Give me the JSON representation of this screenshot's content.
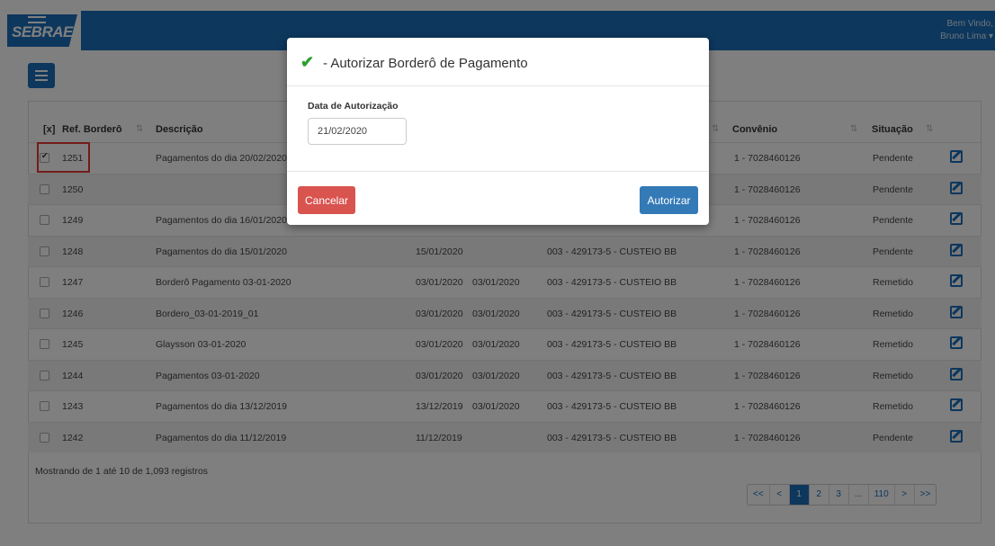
{
  "header": {
    "logo_text": "SEBRAE",
    "welcome": "Bem Vindo,",
    "user_name": "Bruno Lima ▾"
  },
  "table": {
    "columns": [
      "[x]",
      "Ref. Borderô",
      "Descrição",
      "Convênio",
      "Situação"
    ],
    "rows": [
      {
        "ref": "1251",
        "desc": "Pagamentos do dia 20/02/2020",
        "date1": "",
        "date2": "",
        "conta": "",
        "convenio": "1 - 7028460126",
        "situacao": "Pendente",
        "checked": true
      },
      {
        "ref": "1250",
        "desc": "",
        "date1": "",
        "date2": "",
        "conta": "",
        "convenio": "1 - 7028460126",
        "situacao": "Pendente",
        "checked": false
      },
      {
        "ref": "1249",
        "desc": "Pagamentos do dia 16/01/2020",
        "date1": "",
        "date2": "",
        "conta": "",
        "convenio": "1 - 7028460126",
        "situacao": "Pendente",
        "checked": false
      },
      {
        "ref": "1248",
        "desc": "Pagamentos do dia 15/01/2020",
        "date1": "15/01/2020",
        "date2": "",
        "conta": "003 - 429173-5 - CUSTEIO BB",
        "convenio": "1 - 7028460126",
        "situacao": "Pendente",
        "checked": false
      },
      {
        "ref": "1247",
        "desc": "Borderô Pagamento 03-01-2020",
        "date1": "03/01/2020",
        "date2": "03/01/2020",
        "conta": "003 - 429173-5 - CUSTEIO BB",
        "convenio": "1 - 7028460126",
        "situacao": "Remetido",
        "checked": false
      },
      {
        "ref": "1246",
        "desc": "Bordero_03-01-2019_01",
        "date1": "03/01/2020",
        "date2": "03/01/2020",
        "conta": "003 - 429173-5 - CUSTEIO BB",
        "convenio": "1 - 7028460126",
        "situacao": "Remetido",
        "checked": false
      },
      {
        "ref": "1245",
        "desc": "Glaysson 03-01-2020",
        "date1": "03/01/2020",
        "date2": "03/01/2020",
        "conta": "003 - 429173-5 - CUSTEIO BB",
        "convenio": "1 - 7028460126",
        "situacao": "Remetido",
        "checked": false
      },
      {
        "ref": "1244",
        "desc": "Pagamentos 03-01-2020",
        "date1": "03/01/2020",
        "date2": "03/01/2020",
        "conta": "003 - 429173-5 - CUSTEIO BB",
        "convenio": "1 - 7028460126",
        "situacao": "Remetido",
        "checked": false
      },
      {
        "ref": "1243",
        "desc": "Pagamentos do dia 13/12/2019",
        "date1": "13/12/2019",
        "date2": "03/01/2020",
        "conta": "003 - 429173-5 - CUSTEIO BB",
        "convenio": "1 - 7028460126",
        "situacao": "Remetido",
        "checked": false
      },
      {
        "ref": "1242",
        "desc": "Pagamentos do dia 11/12/2019",
        "date1": "11/12/2019",
        "date2": "",
        "conta": "003 - 429173-5 - CUSTEIO BB",
        "convenio": "1 - 7028460126",
        "situacao": "Pendente",
        "checked": false
      }
    ]
  },
  "footer": {
    "info": "Mostrando de 1 até 10 de 1,093 registros"
  },
  "pagination": [
    "<<",
    "<",
    "1",
    "2",
    "3",
    "...",
    "110",
    ">",
    ">>"
  ],
  "pagination_active": "1",
  "modal": {
    "title": "- Autorizar Borderô de Pagamento",
    "field_label": "Data de Autorização",
    "field_value": "21/02/2020",
    "cancel_label": "Cancelar",
    "confirm_label": "Autorizar"
  },
  "colors": {
    "brand": "#1b6fba",
    "danger": "#d9534f",
    "primary": "#337ab7",
    "success": "#2e9e2e"
  }
}
